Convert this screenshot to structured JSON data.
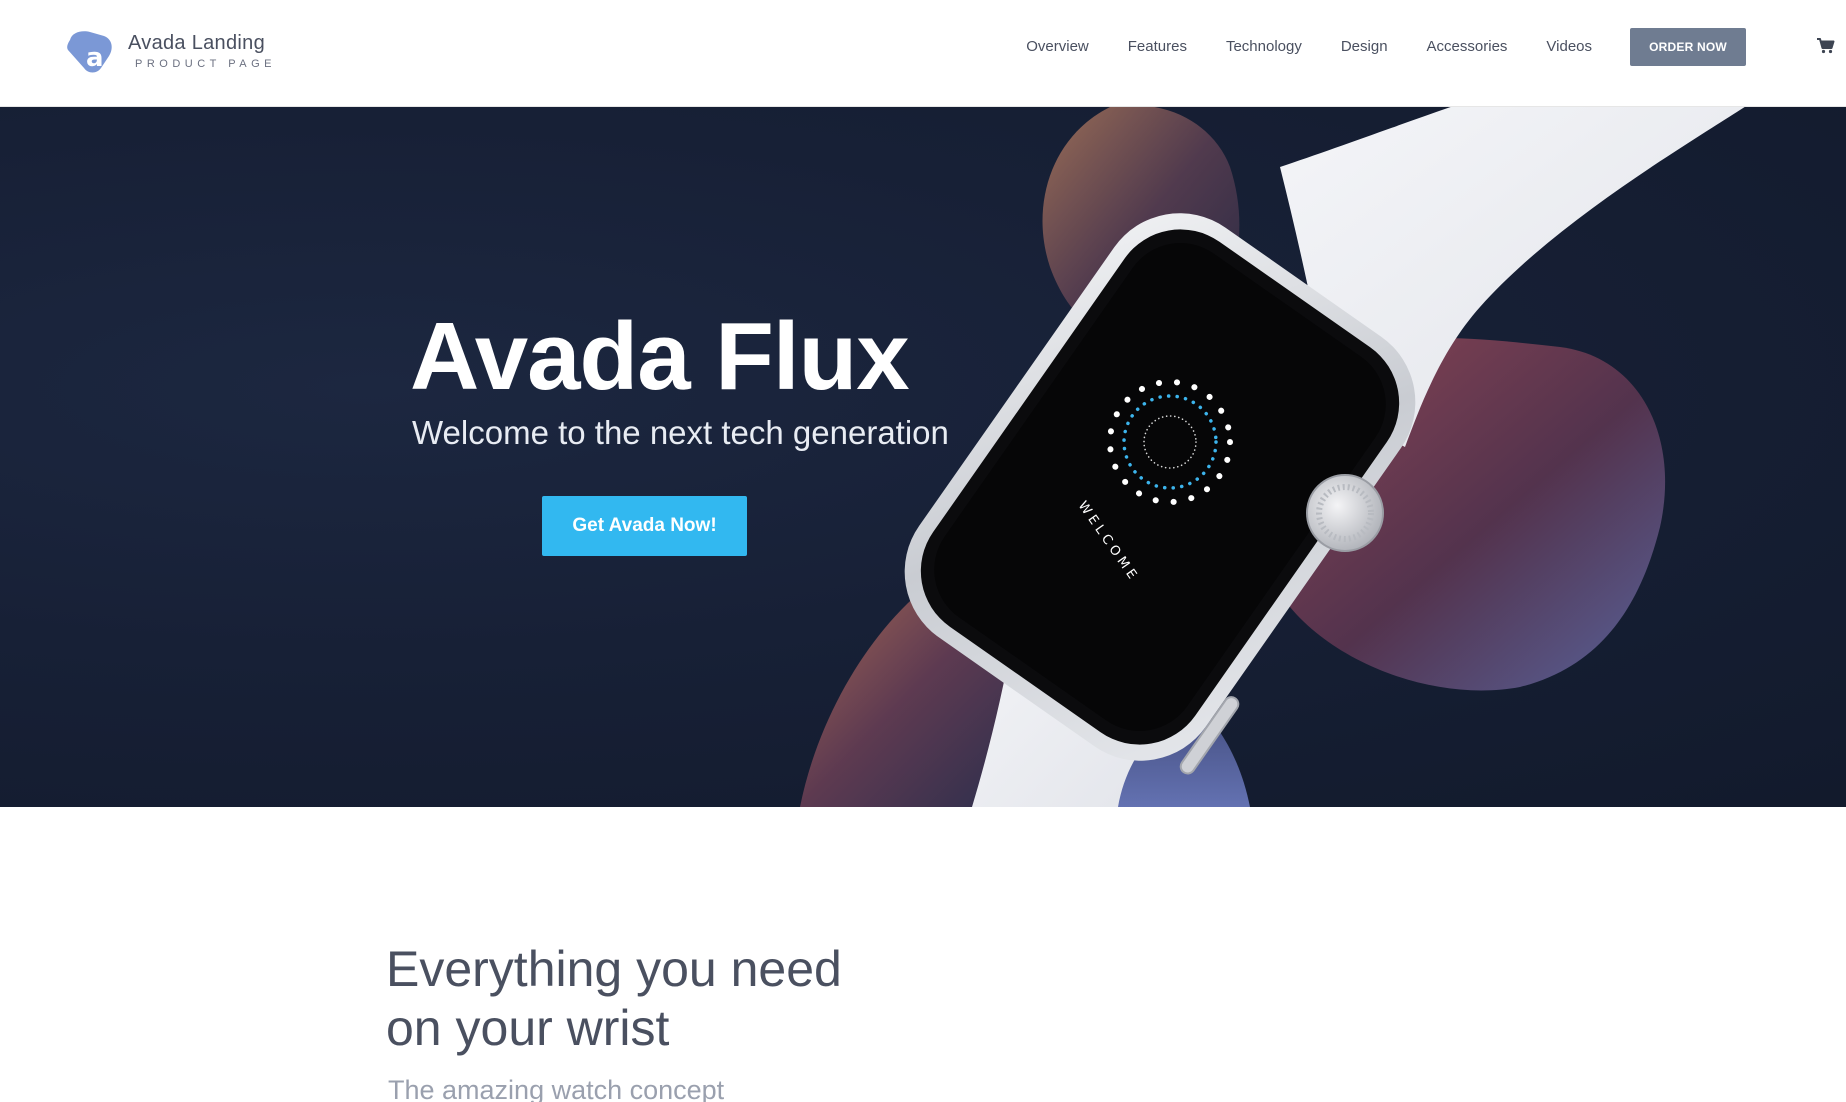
{
  "brand": {
    "name": "Avada Landing",
    "tagline": "PRODUCT PAGE",
    "logo_color": "#7b98d6"
  },
  "nav": {
    "items": [
      {
        "label": "Overview"
      },
      {
        "label": "Features"
      },
      {
        "label": "Technology"
      },
      {
        "label": "Design"
      },
      {
        "label": "Accessories"
      },
      {
        "label": "Videos"
      }
    ],
    "order_label": "ORDER NOW",
    "cart_icon": "shopping-cart-icon"
  },
  "hero": {
    "title": "Avada Flux",
    "subtitle": "Welcome to the next tech generation",
    "cta_label": "Get Avada Now!",
    "watch_screen_text": "WELCOME",
    "accent_color": "#32b8f0",
    "background_color": "#172036"
  },
  "section": {
    "title_line1": "Everything you need",
    "title_line2": "on your wrist",
    "subtitle": "The amazing watch concept"
  }
}
